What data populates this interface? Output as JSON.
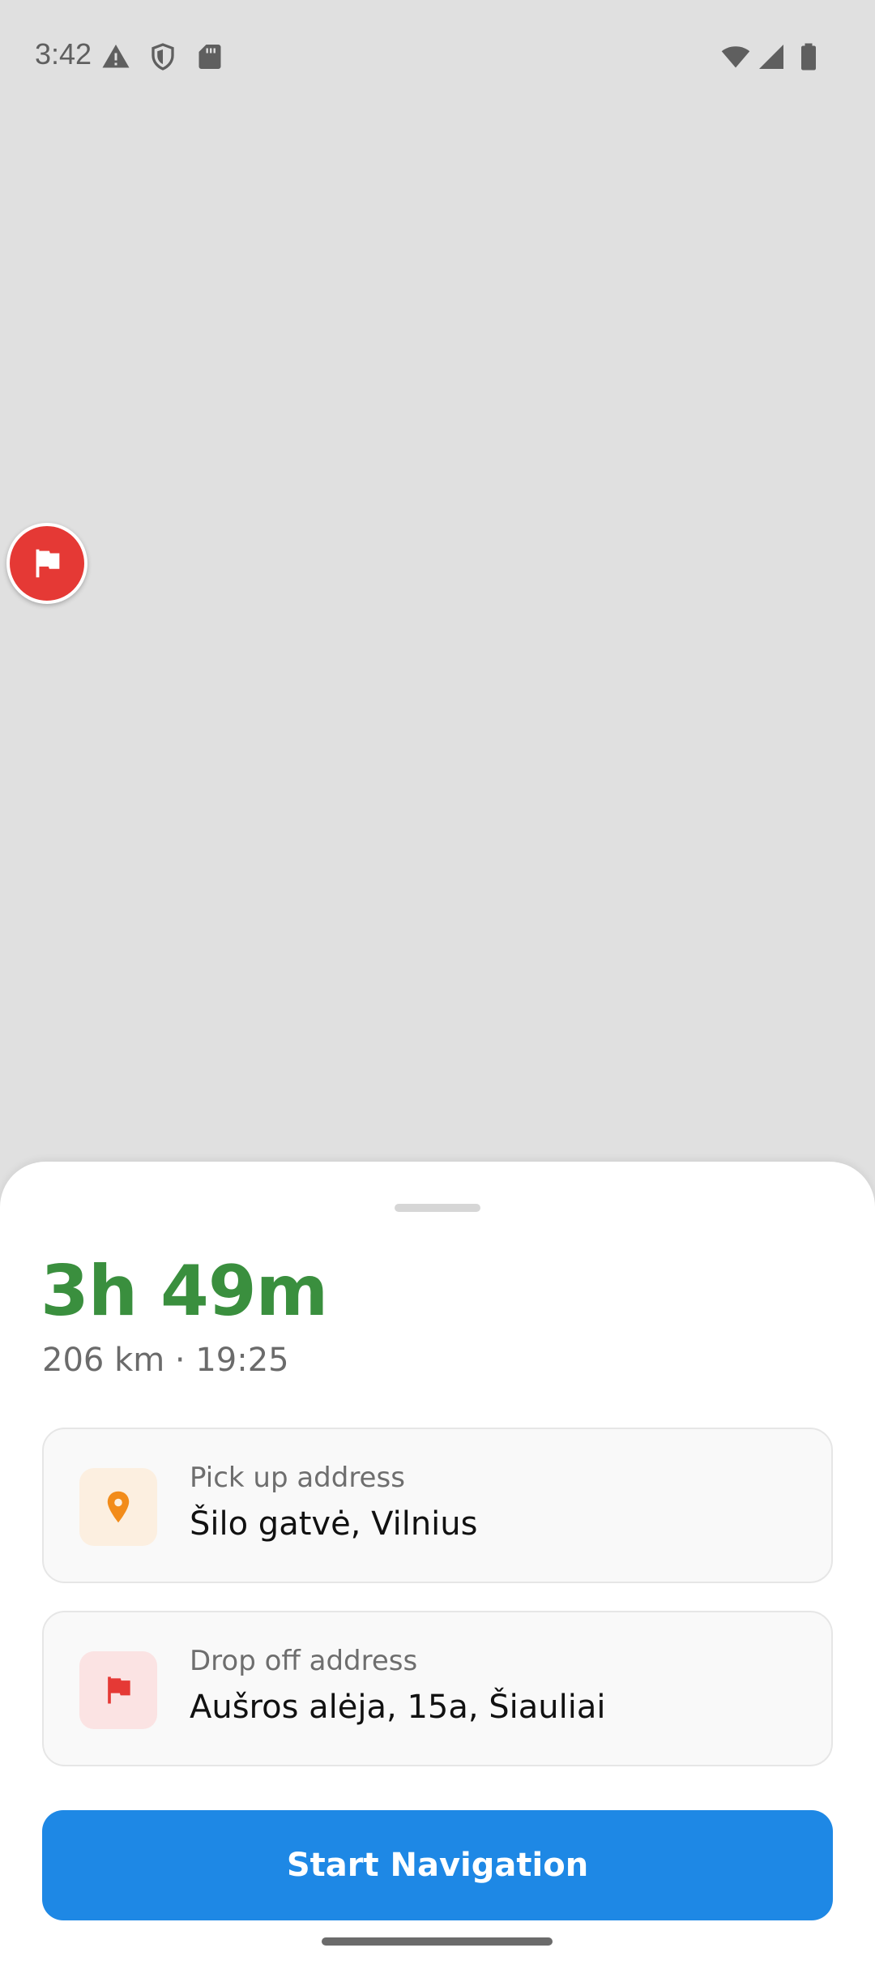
{
  "status_bar": {
    "time": "3:42",
    "left_icons": [
      "warning-icon",
      "shield-icon",
      "sd-card-icon"
    ],
    "right_icons": [
      "wifi-icon",
      "cell-signal-icon",
      "battery-icon"
    ]
  },
  "map": {
    "destination_marker_icon": "flag-icon",
    "marker_color": "#e53935"
  },
  "route": {
    "duration": "3h 49m",
    "summary": "206 km · 19:25",
    "duration_color": "#3a8f3e"
  },
  "pickup": {
    "label": "Pick up address",
    "value": "Šilo gatvė, Vilnius",
    "icon": "location-pin-icon",
    "icon_color": "#f28c1b"
  },
  "dropoff": {
    "label": "Drop off address",
    "value": "Aušros alėja, 15a, Šiauliai",
    "icon": "flag-icon",
    "icon_color": "#e53935"
  },
  "actions": {
    "start_navigation_label": "Start Navigation",
    "button_color": "#1e88e5"
  }
}
